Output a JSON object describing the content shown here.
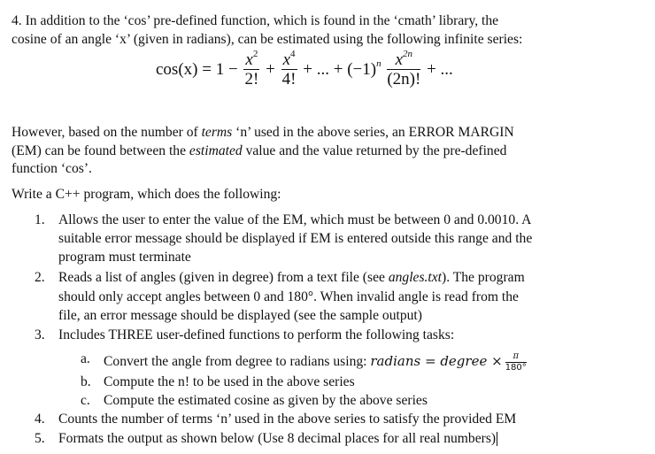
{
  "question": {
    "intro_line1": "4. In addition to the ‘cos’ pre-defined function, which is found in the ‘cmath’ library, the",
    "intro_line2": "cosine of an angle ‘x’ (given in radians), can be estimated using the following infinite series:",
    "formula": {
      "lhs": "cos(x) = 1 −",
      "t1_num": "x",
      "t1_exp": "2",
      "t1_den": "2!",
      "plus1": "+",
      "t2_num": "x",
      "t2_exp": "4",
      "t2_den": "4!",
      "middle": "+ ... + (−1)",
      "middle_exp": "n",
      "tn_num": "x",
      "tn_exp": "2n",
      "tn_den": "(2n)!",
      "tail": "+ ..."
    },
    "however_line1_a": "However, based on the number of ",
    "however_line1_em": "terms",
    "however_line1_b": " ‘n’ used in the above series, an ERROR MARGIN",
    "however_line2_a": "(EM) can be found between the ",
    "however_line2_em": "estimated",
    "however_line2_b": " value and the value returned by the pre-defined",
    "however_line3": "function ‘cos’.",
    "write_line": "Write a C++ program, which does the following:",
    "items": [
      {
        "num": "1.",
        "lines": [
          "Allows the user to enter the value of the EM, which must be between 0 and 0.0010. A",
          "suitable error message should be displayed if EM is entered outside this range and the",
          "program must terminate"
        ]
      },
      {
        "num": "2.",
        "line1_a": "Reads a list of angles (given in degree) from a text file (see ",
        "line1_em": "angles.txt",
        "line1_b": "). The program",
        "lines": [
          "should only accept angles between 0 and 180°. When invalid angle is read from the",
          "file, an error message should be displayed (see the sample output)"
        ]
      },
      {
        "num": "3.",
        "lines": [
          "Includes THREE user-defined functions to perform the following tasks:"
        ]
      },
      {
        "num": "4.",
        "lines": [
          "Counts the number of terms ‘n’ used in the above series to satisfy the provided EM"
        ]
      },
      {
        "num": "5.",
        "lines": [
          "Formats the output as shown below (Use 8 decimal places for all real numbers)"
        ]
      }
    ],
    "subitems": [
      {
        "letter": "a.",
        "text": "Convert the angle from degree to radians using: ",
        "math_lhs": "radians",
        "math_eq": " = ",
        "math_rhs": "degree",
        "math_times": " ×",
        "frac_num": "π",
        "frac_den": "180°"
      },
      {
        "letter": "b.",
        "text": "Compute the n! to be used in the above series"
      },
      {
        "letter": "c.",
        "text": "Compute the estimated cosine as given by the above series"
      }
    ]
  }
}
